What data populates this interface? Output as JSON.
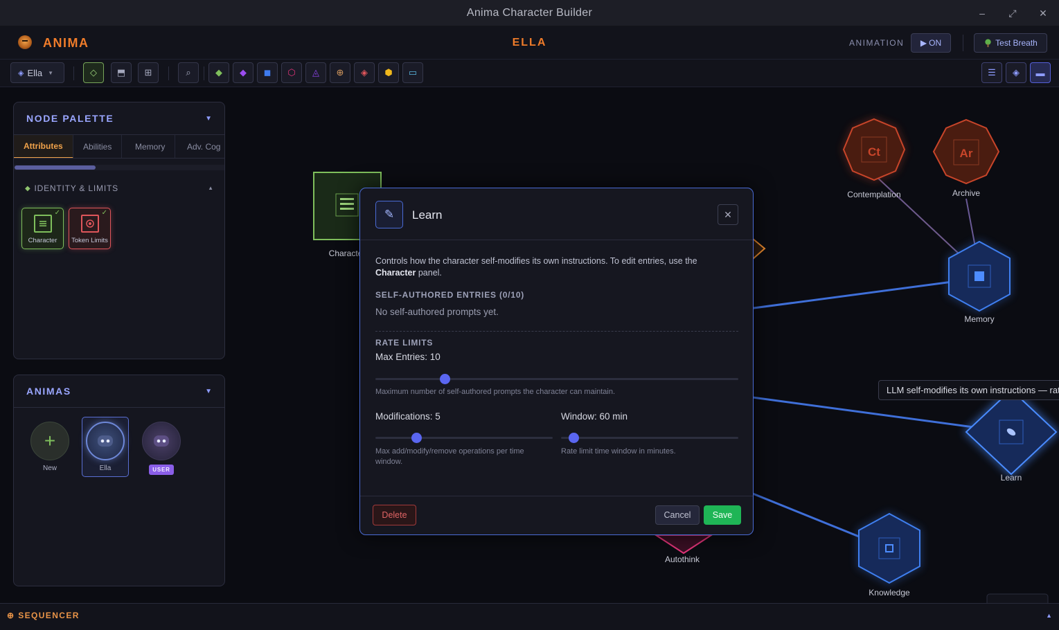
{
  "window": {
    "title": "Anima Character Builder",
    "controls": [
      "–",
      "⤢",
      "✕"
    ]
  },
  "header": {
    "app_name": "ANIMA",
    "character_name": "ELLA",
    "animation_label": "ANIMATION",
    "animation_toggle": "ON",
    "test_breath_label": "Test Breath"
  },
  "toolbar": {
    "anima_select": "Ella",
    "left_tools": [
      "diamond-outline-icon",
      "panel-icon",
      "grid-icon",
      "search-icon"
    ],
    "node_tools": [
      "green-diamond-icon",
      "purple-diamond-icon",
      "blue-square-icon",
      "pink-hexagon-icon",
      "purple-triangle-icon",
      "crosshair-icon",
      "red-diamond-icon",
      "yellow-hexagon-icon",
      "laptop-icon"
    ],
    "right_tools": [
      "list-icon",
      "diamond-icon",
      "minimize-icon"
    ]
  },
  "node_palette": {
    "title": "NODE PALETTE",
    "tabs": [
      "Attributes",
      "Abilities",
      "Memory",
      "Adv. Cog"
    ],
    "active_tab": "Attributes",
    "section": "IDENTITY & LIMITS",
    "nodes": [
      {
        "label": "Character",
        "color": "#7fbf5c"
      },
      {
        "label": "Token Limits",
        "color": "#e0565b"
      }
    ]
  },
  "animas": {
    "title": "ANIMAS",
    "items": [
      {
        "label": "New"
      },
      {
        "label": "Ella"
      },
      {
        "label": "USER"
      }
    ]
  },
  "canvas": {
    "nodes": {
      "contemplation": {
        "label": "Contemplation",
        "glyph": "Ct"
      },
      "archive": {
        "label": "Archive",
        "glyph": "Ar"
      },
      "memory": {
        "label": "Memory"
      },
      "learn": {
        "label": "Learn"
      },
      "knowledge": {
        "label": "Knowledge"
      },
      "autothink": {
        "label": "Autothink"
      },
      "character": {
        "label": "Character"
      }
    },
    "tooltip": "LLM self-modifies its own instructions — rate"
  },
  "modal": {
    "title": "Learn",
    "description_pre": "Controls how the character self-modifies its own instructions. To edit entries, use the ",
    "description_bold": "Character",
    "description_post": " panel.",
    "entries_heading": "SELF-AUTHORED ENTRIES (0/10)",
    "entries_empty": "No self-authored prompts yet.",
    "rate_heading": "RATE LIMITS",
    "max_entries": {
      "label": "Max Entries: 10",
      "value": 10,
      "fraction": 0.19,
      "help": "Maximum number of self-authored prompts the character can maintain."
    },
    "modifications": {
      "label": "Modifications: 5",
      "value": 5,
      "fraction": 0.23,
      "help": "Max add/modify/remove operations per time window."
    },
    "window": {
      "label": "Window: 60 min",
      "value": 60,
      "fraction": 0.07,
      "help": "Rate limit time window in minutes."
    },
    "delete_label": "Delete",
    "cancel_label": "Cancel",
    "save_label": "Save"
  },
  "sequencer": {
    "title": "SEQUENCER"
  },
  "colors": {
    "accent_orange": "#f07c2a",
    "accent_blue": "#4a6bd6",
    "save_green": "#1fb556",
    "delete_red": "#e06464"
  }
}
